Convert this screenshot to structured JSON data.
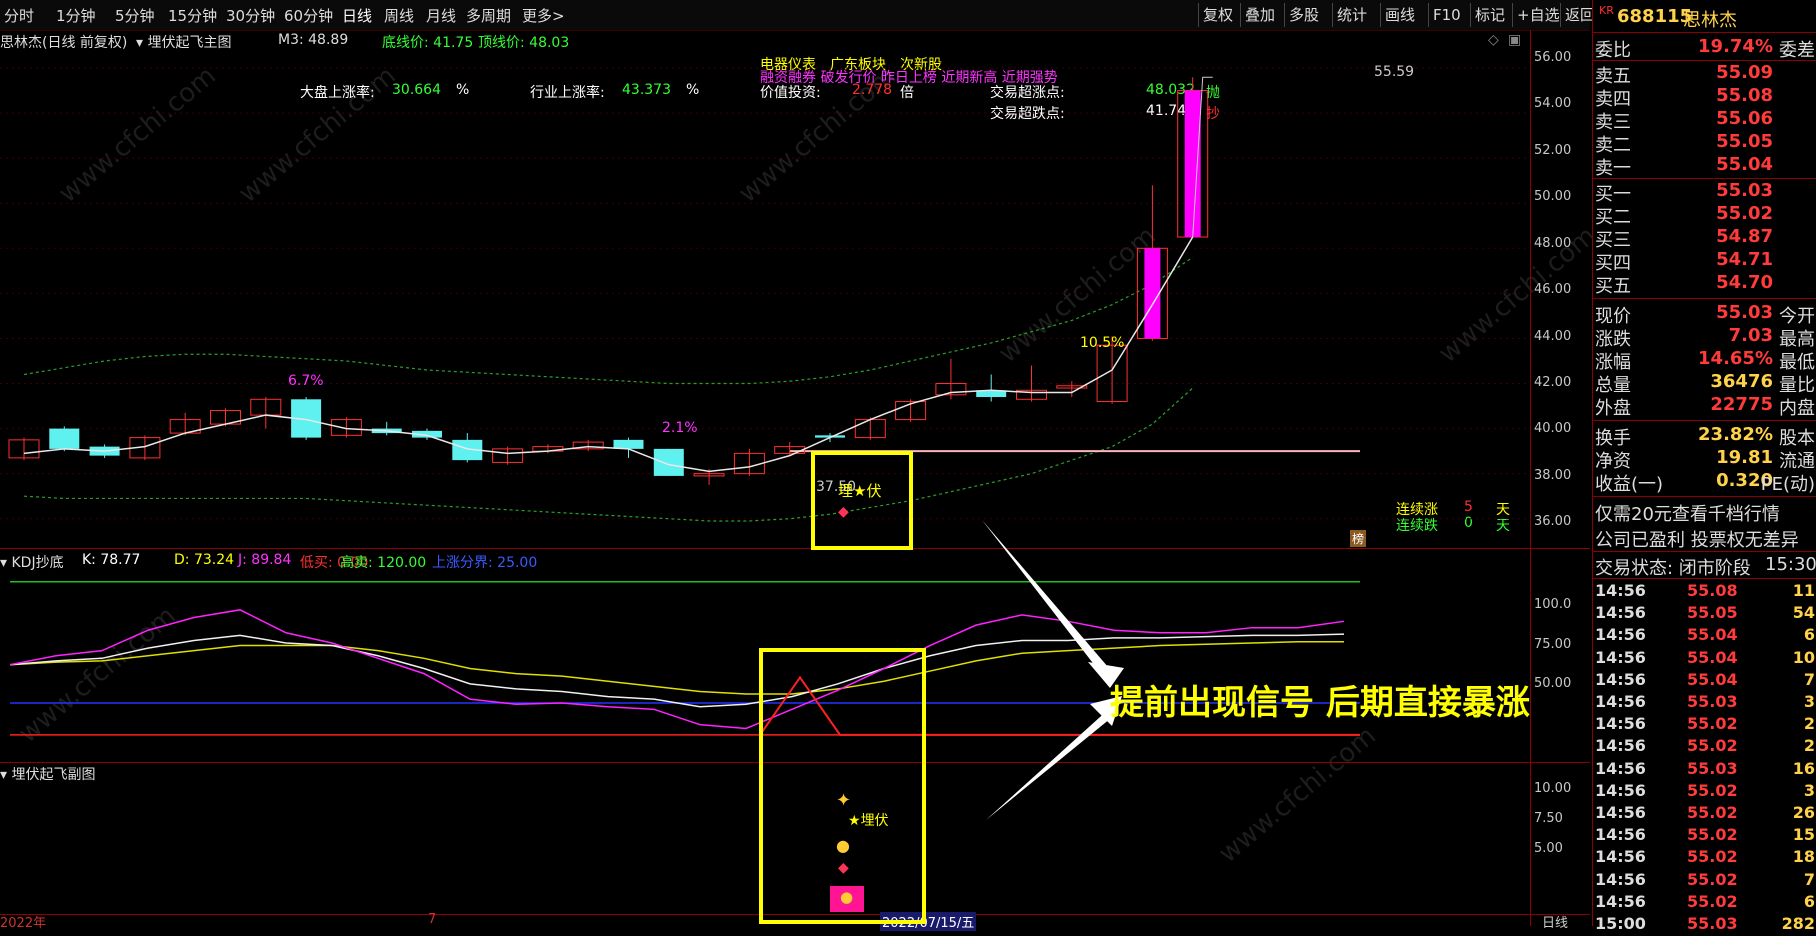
{
  "toolbar": {
    "periods": [
      "分时",
      "1分钟",
      "5分钟",
      "15分钟",
      "30分钟",
      "60分钟",
      "日线",
      "周线",
      "月线",
      "多周期",
      "更多>"
    ],
    "active_period": "日线",
    "right_buttons": [
      "复权",
      "叠加",
      "多股",
      "统计",
      "画线",
      "F10",
      "标记",
      "+自选",
      "返回"
    ]
  },
  "main_header": {
    "title": "思林杰(日线 前复权)",
    "indicator": "埋伏起飞主图",
    "m3": "M3: 48.89",
    "low_line": "底线价: 41.75",
    "top_line": "顶线价: 48.03"
  },
  "info": {
    "market_rise_label": "大盘上涨率:",
    "market_rise_value": "30.664",
    "market_rise_unit": "%",
    "industry_rise_label": "行业上涨率:",
    "industry_rise_value": "43.373",
    "industry_rise_unit": "%",
    "sector_line": "电器仪表　广东板块　次新股",
    "tags_line": "融资融券 破发行价 昨日上榜 近期新高 近期强势",
    "value_label": "价值投资:",
    "value_value": "2.778",
    "value_unit": "倍",
    "oversold_up_label": "交易超涨点:",
    "oversold_up_value": "48.032",
    "oversold_up_action": "抛",
    "oversold_down_label": "交易超跌点:",
    "oversold_down_value": "41.747",
    "oversold_down_action": "抄",
    "consec_up_label": "连续涨",
    "consec_up_value": "5",
    "consec_up_unit": "天",
    "consec_down_label": "连续跌",
    "consec_down_value": "0",
    "consec_down_unit": "天",
    "pct_annot_1": "6.7%",
    "pct_annot_2": "2.1%",
    "pct_annot_3": "10.5%",
    "high_label": "55.59",
    "low_label": "37.50",
    "signal_text": "埋★伏",
    "bang_badge": "榜"
  },
  "kdj": {
    "title": "KDJ抄底",
    "k": "K: 78.77",
    "d": "D: 73.24",
    "j": "J: 89.84",
    "low_buy": "低买: 0.00",
    "high_sell": "高卖: 120.00",
    "rise_bound": "上涨分界: 25.00"
  },
  "sub": {
    "title": "埋伏起飞副图",
    "signal_text": "埋伏"
  },
  "annotation": {
    "text": "提前出现信号  后期直接暴涨"
  },
  "axis": {
    "main_ticks": [
      "56.00",
      "54.00",
      "52.00",
      "50.00",
      "48.00",
      "46.00",
      "44.00",
      "42.00",
      "40.00",
      "38.00",
      "36.00"
    ],
    "kdj_ticks": [
      "100.0",
      "75.00",
      "50.00"
    ],
    "sub_ticks": [
      "10.00",
      "7.50",
      "5.00"
    ],
    "bottom_left": "2022年",
    "bottom_mid": "7",
    "bottom_date": "2022/07/15/五",
    "bottom_right": "日线"
  },
  "quote": {
    "code": "688115",
    "name": "思林杰",
    "kr": "KR",
    "wei_bi_label": "委比",
    "wei_bi_value": "19.74%",
    "wei_cha_label": "委差",
    "asks": [
      {
        "label": "卖五",
        "price": "55.09"
      },
      {
        "label": "卖四",
        "price": "55.08"
      },
      {
        "label": "卖三",
        "price": "55.06"
      },
      {
        "label": "卖二",
        "price": "55.05"
      },
      {
        "label": "卖一",
        "price": "55.04"
      }
    ],
    "bids": [
      {
        "label": "买一",
        "price": "55.03"
      },
      {
        "label": "买二",
        "price": "55.02"
      },
      {
        "label": "买三",
        "price": "54.87"
      },
      {
        "label": "买四",
        "price": "54.71"
      },
      {
        "label": "买五",
        "price": "54.70"
      }
    ],
    "stats": [
      {
        "label": "现价",
        "value": "55.03",
        "label2": "今开"
      },
      {
        "label": "涨跌",
        "value": "7.03",
        "label2": "最高"
      },
      {
        "label": "涨幅",
        "value": "14.65%",
        "label2": "最低"
      },
      {
        "label": "总量",
        "value": "36476",
        "label2": "量比"
      },
      {
        "label": "外盘",
        "value": "22775",
        "label2": "内盘"
      }
    ],
    "stats2": [
      {
        "label": "换手",
        "value": "23.82%",
        "label2": "股本"
      },
      {
        "label": "净资",
        "value": "19.81",
        "label2": "流通"
      },
      {
        "label": "收益(一)",
        "value": "0.320",
        "label2": "PE(动)"
      }
    ],
    "promo1": "仅需20元查看千档行情",
    "promo2": "公司已盈利 投票权无差异",
    "status_label": "交易状态: 闭市阶段",
    "status_time": "15:30",
    "ticks": [
      {
        "t": "14:56",
        "p": "55.08",
        "v": "11"
      },
      {
        "t": "14:56",
        "p": "55.05",
        "v": "54"
      },
      {
        "t": "14:56",
        "p": "55.04",
        "v": "6"
      },
      {
        "t": "14:56",
        "p": "55.04",
        "v": "10"
      },
      {
        "t": "14:56",
        "p": "55.04",
        "v": "7"
      },
      {
        "t": "14:56",
        "p": "55.03",
        "v": "3"
      },
      {
        "t": "14:56",
        "p": "55.02",
        "v": "2"
      },
      {
        "t": "14:56",
        "p": "55.02",
        "v": "2"
      },
      {
        "t": "14:56",
        "p": "55.03",
        "v": "16"
      },
      {
        "t": "14:56",
        "p": "55.02",
        "v": "3"
      },
      {
        "t": "14:56",
        "p": "55.02",
        "v": "26"
      },
      {
        "t": "14:56",
        "p": "55.02",
        "v": "15"
      },
      {
        "t": "14:56",
        "p": "55.02",
        "v": "18"
      },
      {
        "t": "14:56",
        "p": "55.02",
        "v": "7"
      },
      {
        "t": "14:56",
        "p": "55.02",
        "v": "6"
      },
      {
        "t": "15:00",
        "p": "55.03",
        "v": "282"
      }
    ]
  },
  "chart_data": {
    "type": "candlestick",
    "ylim": [
      35.5,
      56.8
    ],
    "candles": [
      {
        "o": 38.7,
        "c": 39.5,
        "h": 39.6,
        "l": 38.6
      },
      {
        "o": 40.0,
        "c": 39.1,
        "h": 40.1,
        "l": 39.0
      },
      {
        "o": 39.2,
        "c": 38.8,
        "h": 39.3,
        "l": 38.7
      },
      {
        "o": 38.7,
        "c": 39.6,
        "h": 39.7,
        "l": 38.6
      },
      {
        "o": 39.8,
        "c": 40.4,
        "h": 40.7,
        "l": 39.7
      },
      {
        "o": 40.2,
        "c": 40.8,
        "h": 40.9,
        "l": 40.1
      },
      {
        "o": 40.6,
        "c": 41.3,
        "h": 41.4,
        "l": 40.0
      },
      {
        "o": 41.3,
        "c": 39.6,
        "h": 41.4,
        "l": 39.5
      },
      {
        "o": 39.7,
        "c": 40.4,
        "h": 40.5,
        "l": 39.6
      },
      {
        "o": 40.0,
        "c": 39.8,
        "h": 40.3,
        "l": 39.7
      },
      {
        "o": 39.9,
        "c": 39.6,
        "h": 40.0,
        "l": 39.5
      },
      {
        "o": 39.5,
        "c": 38.6,
        "h": 39.8,
        "l": 38.5
      },
      {
        "o": 38.5,
        "c": 39.1,
        "h": 39.2,
        "l": 38.4
      },
      {
        "o": 39.0,
        "c": 39.2,
        "h": 39.3,
        "l": 38.9
      },
      {
        "o": 39.1,
        "c": 39.4,
        "h": 39.5,
        "l": 39.0
      },
      {
        "o": 39.5,
        "c": 39.1,
        "h": 39.6,
        "l": 38.7
      },
      {
        "o": 39.1,
        "c": 37.9,
        "h": 39.1,
        "l": 37.9
      },
      {
        "o": 37.9,
        "c": 38.0,
        "h": 38.2,
        "l": 37.5
      },
      {
        "o": 38.0,
        "c": 38.9,
        "h": 39.1,
        "l": 37.9
      },
      {
        "o": 38.9,
        "c": 39.2,
        "h": 39.4,
        "l": 38.8
      },
      {
        "o": 39.7,
        "c": 39.6,
        "h": 39.8,
        "l": 39.4
      },
      {
        "o": 39.6,
        "c": 40.4,
        "h": 40.5,
        "l": 39.5
      },
      {
        "o": 40.4,
        "c": 41.2,
        "h": 41.3,
        "l": 40.3
      },
      {
        "o": 41.5,
        "c": 42.0,
        "h": 43.1,
        "l": 41.3
      },
      {
        "o": 41.7,
        "c": 41.4,
        "h": 42.4,
        "l": 41.2
      },
      {
        "o": 41.3,
        "c": 41.7,
        "h": 42.8,
        "l": 41.2
      },
      {
        "o": 41.8,
        "c": 41.9,
        "h": 42.1,
        "l": 41.4
      },
      {
        "o": 41.2,
        "c": 43.7,
        "h": 44.1,
        "l": 41.1
      },
      {
        "o": 44.0,
        "c": 48.0,
        "h": 50.8,
        "l": 43.9
      },
      {
        "o": 48.5,
        "c": 55.0,
        "h": 55.59,
        "l": 48.5
      }
    ]
  }
}
